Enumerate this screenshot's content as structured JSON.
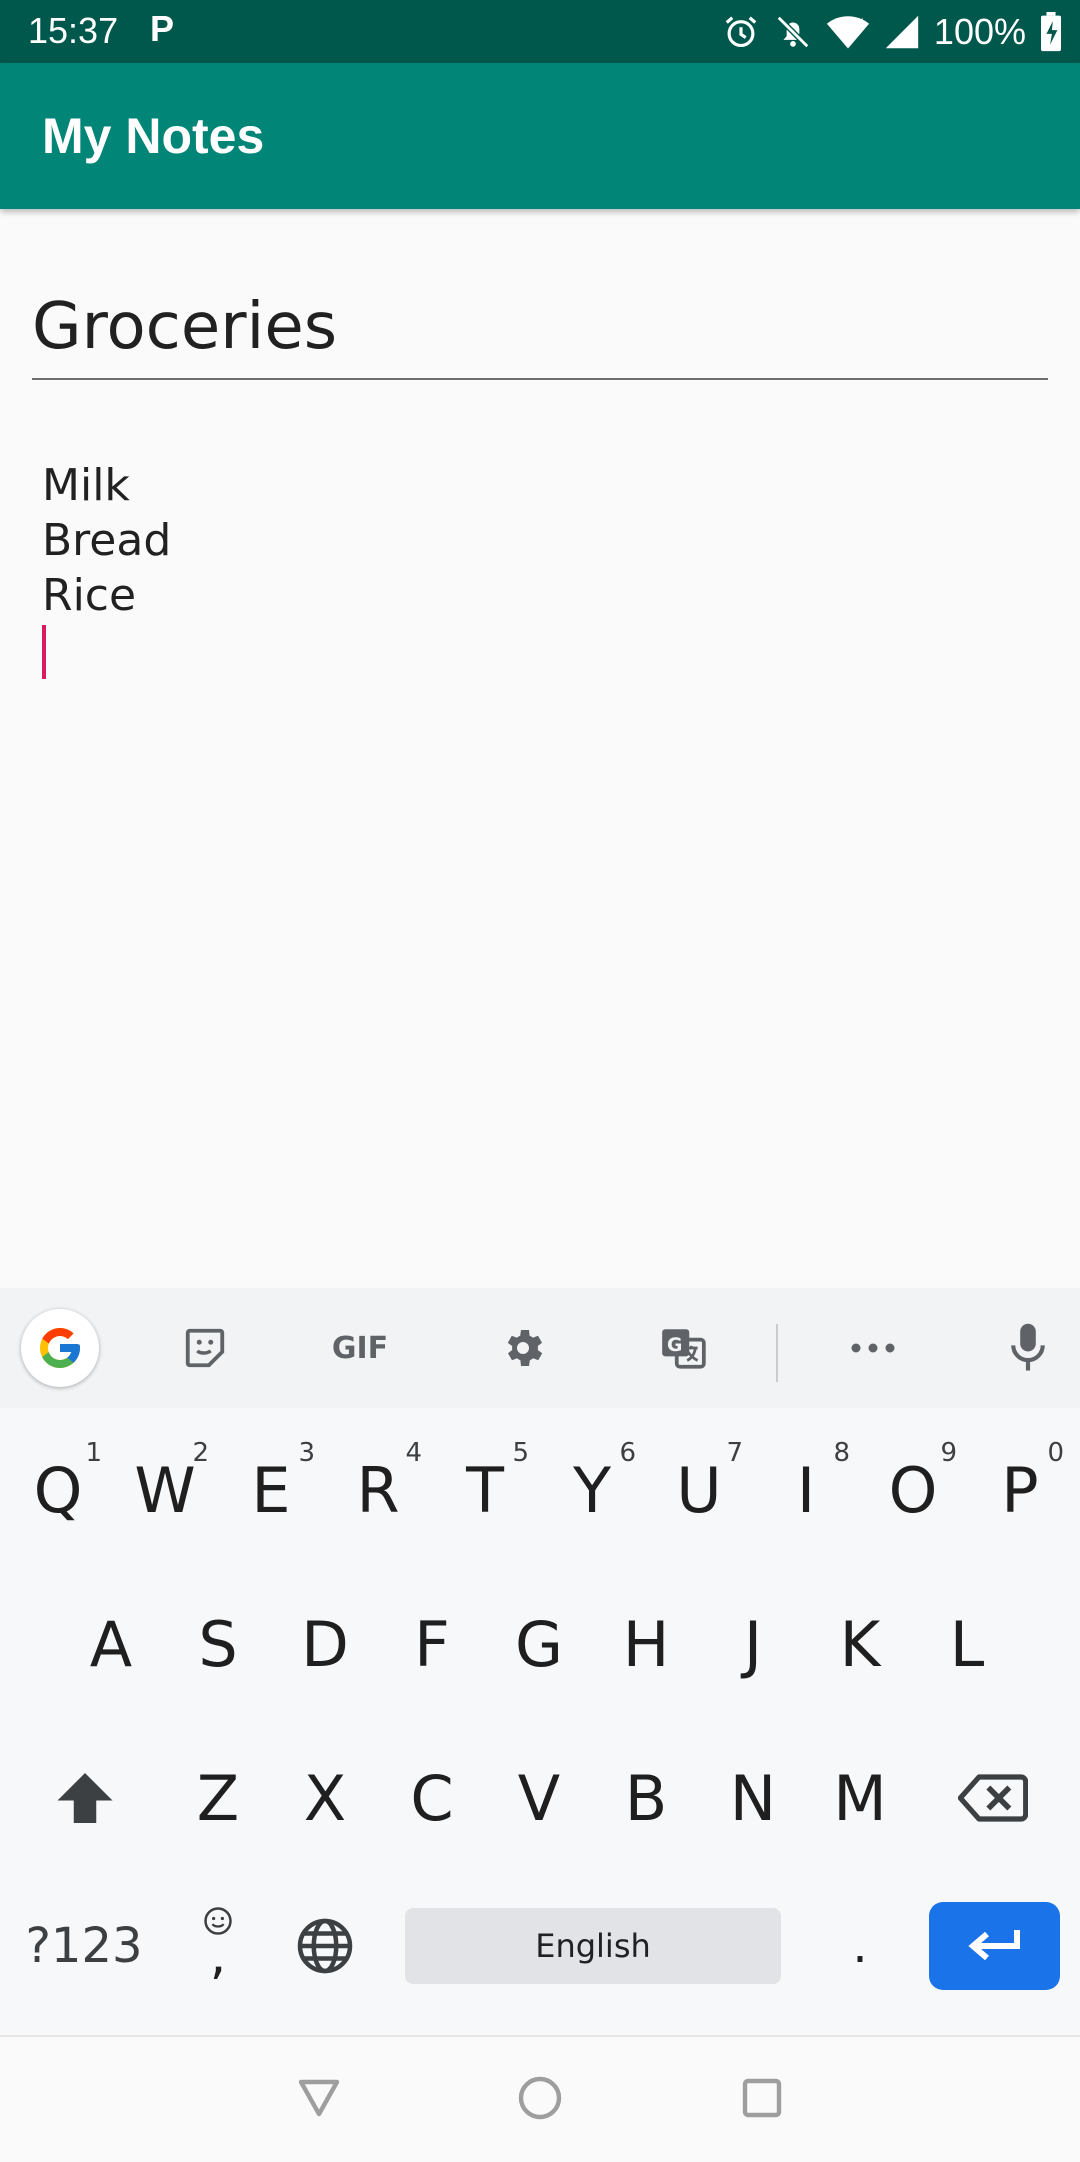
{
  "status_bar": {
    "time": "15:37",
    "notification_letter": "P",
    "battery_percent": "100%",
    "icons": [
      "alarm-icon",
      "notifications-off-icon",
      "wifi-icon",
      "cell-signal-icon",
      "battery-icon"
    ]
  },
  "app_bar": {
    "title": "My Notes",
    "color": "#008577"
  },
  "note": {
    "title": "Groceries",
    "body_lines": [
      "Milk",
      "Bread",
      "Rice"
    ]
  },
  "keyboard": {
    "toolbar": [
      "google-icon",
      "sticker-icon",
      "gif-icon",
      "settings-icon",
      "translate-icon",
      "more-icon",
      "mic-icon"
    ],
    "gif_label": "GIF",
    "row1": [
      {
        "key": "Q",
        "hint": "1"
      },
      {
        "key": "W",
        "hint": "2"
      },
      {
        "key": "E",
        "hint": "3"
      },
      {
        "key": "R",
        "hint": "4"
      },
      {
        "key": "T",
        "hint": "5"
      },
      {
        "key": "Y",
        "hint": "6"
      },
      {
        "key": "U",
        "hint": "7"
      },
      {
        "key": "I",
        "hint": "8"
      },
      {
        "key": "O",
        "hint": "9"
      },
      {
        "key": "P",
        "hint": "0"
      }
    ],
    "row2": [
      "A",
      "S",
      "D",
      "F",
      "G",
      "H",
      "J",
      "K",
      "L"
    ],
    "row3": [
      "Z",
      "X",
      "C",
      "V",
      "B",
      "N",
      "M"
    ],
    "symbols_label": "?123",
    "comma_label": ",",
    "space_label": "English",
    "period_label": ".",
    "enter_color": "#1a73e8"
  },
  "nav_bar": {
    "icons": [
      "back-icon",
      "home-icon",
      "recents-icon"
    ]
  }
}
